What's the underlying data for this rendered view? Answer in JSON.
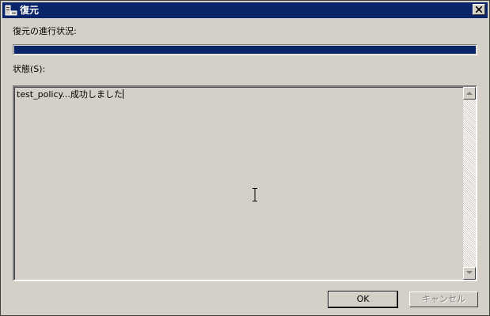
{
  "window": {
    "title": "復元"
  },
  "progress": {
    "label": "復元の進行状況:",
    "value_percent": 100
  },
  "status": {
    "label": "状態(S):",
    "text": "test_policy...成功しました"
  },
  "buttons": {
    "ok": "OK",
    "cancel": "キャンセル"
  },
  "colors": {
    "titlebar": "#0a246a",
    "progress_fill": "#0a246a",
    "face": "#d4d0c8"
  }
}
